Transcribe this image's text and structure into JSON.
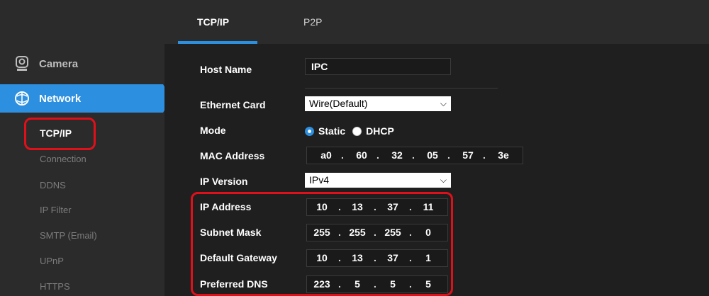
{
  "sidebar": {
    "camera_label": "Camera",
    "network_label": "Network",
    "items": [
      "TCP/IP",
      "Connection",
      "DDNS",
      "IP Filter",
      "SMTP (Email)",
      "UPnP",
      "HTTPS"
    ],
    "active_index": 0
  },
  "tabs": [
    "TCP/IP",
    "P2P"
  ],
  "form": {
    "host_name": {
      "label": "Host Name",
      "value": "IPC"
    },
    "ethernet_card": {
      "label": "Ethernet Card",
      "value": "Wire(Default)"
    },
    "mode": {
      "label": "Mode",
      "options": [
        "Static",
        "DHCP"
      ],
      "selected": "Static"
    },
    "mac_address": {
      "label": "MAC Address",
      "octets": [
        "a0",
        "60",
        "32",
        "05",
        "57",
        "3e"
      ]
    },
    "ip_version": {
      "label": "IP Version",
      "value": "IPv4"
    },
    "ip_address": {
      "label": "IP Address",
      "octets": [
        "10",
        "13",
        "37",
        "11"
      ]
    },
    "subnet_mask": {
      "label": "Subnet Mask",
      "octets": [
        "255",
        "255",
        "255",
        "0"
      ]
    },
    "default_gateway": {
      "label": "Default Gateway",
      "octets": [
        "10",
        "13",
        "37",
        "1"
      ]
    },
    "preferred_dns": {
      "label": "Preferred DNS",
      "octets": [
        "223",
        "5",
        "5",
        "5"
      ]
    }
  },
  "colors": {
    "accent": "#2c8fe0",
    "highlight": "#e0101a",
    "sidebar": "#2b2b2b",
    "background": "#1f1f1f"
  },
  "icons": {
    "camera": "camera-icon",
    "network": "network-icon",
    "dropdown": "chevron-down-icon"
  }
}
